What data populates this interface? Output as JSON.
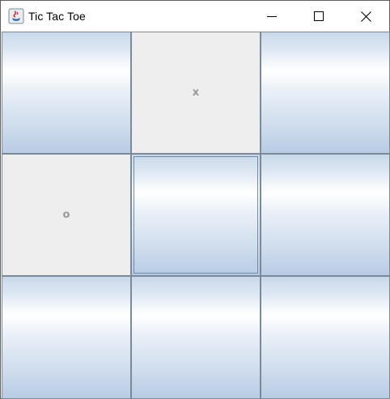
{
  "window": {
    "title": "Tic Tac Toe",
    "app_icon": "java-cup-icon",
    "controls": [
      "minimize-icon",
      "maximize-icon",
      "close-icon"
    ]
  },
  "board": {
    "cells": [
      {
        "row": 1,
        "col": 1,
        "mark": ""
      },
      {
        "row": 1,
        "col": 2,
        "mark": "x"
      },
      {
        "row": 1,
        "col": 3,
        "mark": ""
      },
      {
        "row": 2,
        "col": 1,
        "mark": "o"
      },
      {
        "row": 2,
        "col": 2,
        "mark": ""
      },
      {
        "row": 2,
        "col": 3,
        "mark": ""
      },
      {
        "row": 3,
        "col": 1,
        "mark": ""
      },
      {
        "row": 3,
        "col": 2,
        "mark": ""
      },
      {
        "row": 3,
        "col": 3,
        "mark": ""
      }
    ]
  },
  "colors": {
    "played_cell": "#eeeeee",
    "mark_text": "#999999",
    "grid_line": "#7a8a99"
  }
}
